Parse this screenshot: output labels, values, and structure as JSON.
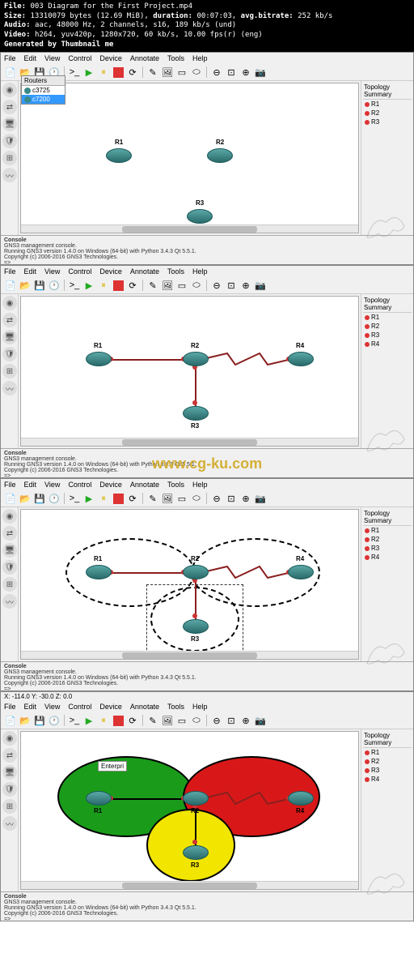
{
  "header": {
    "file_label": "File:",
    "file_value": "003 Diagram for the First Project.mp4",
    "size_label": "Size:",
    "size_value": "13310079 bytes (12.69 MiB),",
    "duration_label": "duration:",
    "duration_value": "00:07:03,",
    "bitrate_label": "avg.bitrate:",
    "bitrate_value": "252 kb/s",
    "audio_label": "Audio:",
    "audio_value": "aac, 48000 Hz, 2 channels, s16, 189 kb/s (und)",
    "video_label": "Video:",
    "video_value": "h264, yuv420p, 1280x720, 60 kb/s, 10.00 fps(r) (eng)",
    "generated": "Generated by Thumbnail me"
  },
  "menu": [
    "File",
    "Edit",
    "View",
    "Control",
    "Device",
    "Annotate",
    "Tools",
    "Help"
  ],
  "routers_panel": {
    "title": "Routers",
    "items": [
      "c3725",
      "c7200"
    ]
  },
  "topo_title": "Topology Summary",
  "f1": {
    "routers": [
      "R1",
      "R2",
      "R3"
    ],
    "topo": [
      "R1",
      "R2",
      "R3"
    ]
  },
  "f2": {
    "routers": [
      "R1",
      "R2",
      "R3",
      "R4"
    ],
    "topo": [
      "R1",
      "R2",
      "R3",
      "R4"
    ]
  },
  "f3": {
    "routers": [
      "R1",
      "R2",
      "R3",
      "R4"
    ],
    "topo": [
      "R1",
      "R2",
      "R3",
      "R4"
    ]
  },
  "f4": {
    "routers": [
      "R1",
      "R2",
      "R3",
      "R4"
    ],
    "topo": [
      "R1",
      "R2",
      "R3",
      "R4"
    ],
    "label": "Enterpri",
    "coords": "X: -114.0 Y: -30.0 Z: 0.0"
  },
  "console": {
    "title": "Console",
    "l1": "GNS3 management console.",
    "l2": "Running GNS3 version 1.4.0 on Windows (64-bit) with Python 3.4.3 Qt 5.5.1.",
    "l3": "Copyright (c) 2006-2016 GNS3 Technologies.",
    "l4": "=>"
  },
  "watermark": "www.cg-ku.com"
}
